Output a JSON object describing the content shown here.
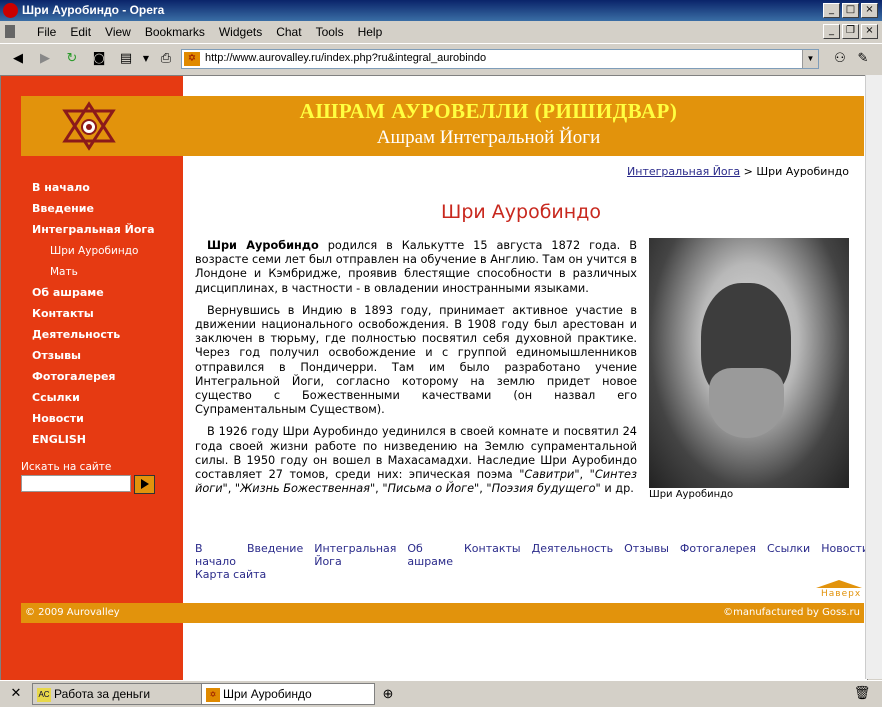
{
  "window": {
    "title": "Шри Ауробиндо - Opera"
  },
  "menu": [
    "File",
    "Edit",
    "View",
    "Bookmarks",
    "Widgets",
    "Chat",
    "Tools",
    "Help"
  ],
  "address": {
    "url": "http://www.aurovalley.ru/index.php?ru&integral_aurobindo"
  },
  "header": {
    "title": "АШРАМ АУРОВЕЛЛИ (РИШИДВАР)",
    "subtitle": "Ашрам Интегральной Йоги"
  },
  "nav": [
    {
      "label": "В начало",
      "sub": false
    },
    {
      "label": "Введение",
      "sub": false
    },
    {
      "label": "Интегральная Йога",
      "sub": false
    },
    {
      "label": "Шри Ауробиндо",
      "sub": true
    },
    {
      "label": "Мать",
      "sub": true
    },
    {
      "label": "Об ашраме",
      "sub": false
    },
    {
      "label": "Контакты",
      "sub": false
    },
    {
      "label": "Деятельность",
      "sub": false
    },
    {
      "label": "Отзывы",
      "sub": false
    },
    {
      "label": "Фотогалерея",
      "sub": false
    },
    {
      "label": "Ссылки",
      "sub": false
    },
    {
      "label": "Новости",
      "sub": false
    },
    {
      "label": "ENGLISH",
      "sub": false
    }
  ],
  "search": {
    "label": "Искать на сайте"
  },
  "breadcrumb": {
    "link": "Интегральная Йога",
    "separator": ">",
    "current": "Шри Ауробиндо"
  },
  "page_title": "Шри Ауробиндо",
  "article": {
    "p1_name": "Шри Ауробиндо",
    "p1": "родился в Калькутте 15 августа 1872 года. В возрасте семи лет был отправлен на обучение в Англию. Там он учится в Лондоне и Кэмбридже, проявив блестящие способности в различных дисциплинах, в частности - в овладении иностранными языками.",
    "p2": "Вернувшись в Индию в 1893 году, принимает активное участие в движении национального освобождения. В 1908 году был арестован и заключен в тюрьму, где полностью посвятил себя духовной практике. Через год получил освобождение и с группой единомышленников отправился в Пондичерри. Там им было разработано учение Интегральной Йоги, согласно которому на землю придет новое существо с Божественными качествами (он назвал его Супраментальным Существом).",
    "p3_start": "В 1926 году Шри Ауробиндо уединился в своей комнате и посвятил 24 года своей жизни работе по низведению на Землю супраментальной силы. В 1950 году он вошел в Махасамадхи. Наследие Шри Ауробиндо составляет 27 томов, среди них: эпическая поэма \"",
    "w1": "Савитри",
    "s1": "\", \"",
    "w2": "Синтез йоги",
    "s2": "\", \"",
    "w3": "Жизнь Божественная",
    "s3": "\", \"",
    "w4": "Письма о Йоге",
    "s4": "\", \"",
    "w5": "Поэзия будущего",
    "s5": "\" и др."
  },
  "photo_caption": "Шри Ауробиндо",
  "footer_nav": [
    "В начало",
    "Введение",
    "Интегральная Йога",
    "Об ашраме",
    "Контакты",
    "Деятельность",
    "Отзывы",
    "Фотогалерея",
    "Ссылки",
    "Новости"
  ],
  "sitemap": "Карта сайта",
  "top_link": "Наверх",
  "footer": {
    "copyright": "© 2009 Aurovalley",
    "manufactured": "©manufactured by Goss.ru"
  },
  "tabs": [
    {
      "label": "Работа за деньги",
      "active": false
    },
    {
      "label": "Шри Ауробиндо",
      "active": true
    }
  ],
  "colors": {
    "red": "#e63a12",
    "orange": "#e2930c",
    "title_red": "#c8281e"
  }
}
